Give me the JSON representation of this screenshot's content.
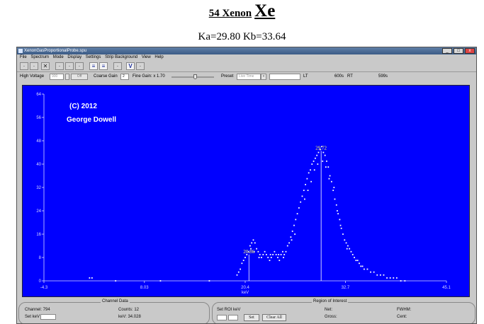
{
  "page": {
    "title_number": "54 Xenon",
    "title_symbol": "Xe",
    "energies": "Ka=29.80 Kb=33.64"
  },
  "window": {
    "title": "XenonGasProportionalProbe.spu"
  },
  "menu": [
    "File",
    "Spectrum",
    "Mode",
    "Display",
    "Settings",
    "Strip Background",
    "View",
    "Help"
  ],
  "controls": {
    "high_voltage_label": "High Voltage",
    "high_voltage_value": "900",
    "off_label": "Off",
    "coarse_gain_label": "Coarse Gain",
    "coarse_gain_value": "2",
    "fine_gain_label": "Fine Gain: x 1.70",
    "preset_label": "Preset",
    "preset_value": "Live Time",
    "lt_label": "LT",
    "time_value": "600s",
    "rt_label": "RT",
    "rt_value": "599s",
    "fine_gain_level": 0.55
  },
  "overlay": {
    "copyright": "(C) 2012",
    "author": "George Dowell"
  },
  "chart_data": {
    "type": "scatter",
    "xlabel": "keV",
    "xlim": [
      -4.3,
      45.1
    ],
    "ylim": [
      0,
      64
    ],
    "x_ticks": [
      "-4.3",
      "8.03",
      "20.4",
      "32.7",
      "45.1"
    ],
    "y_ticks": [
      "0",
      "8",
      "16",
      "24",
      "32",
      "40",
      "48",
      "56",
      "64"
    ],
    "peaks": [
      {
        "label": "20.86",
        "x": 20.86,
        "y": 9.5
      },
      {
        "label": "29.72",
        "x": 29.72,
        "y": 45
      }
    ],
    "points": [
      [
        1.3,
        1
      ],
      [
        1.6,
        1
      ],
      [
        4.5,
        0
      ],
      [
        10,
        0
      ],
      [
        16,
        0
      ],
      [
        19.4,
        2
      ],
      [
        19.6,
        3
      ],
      [
        19.8,
        4
      ],
      [
        20.0,
        6
      ],
      [
        20.2,
        7
      ],
      [
        20.4,
        8
      ],
      [
        20.6,
        9
      ],
      [
        20.8,
        10
      ],
      [
        21.0,
        12
      ],
      [
        21.2,
        13
      ],
      [
        21.4,
        14
      ],
      [
        21.6,
        13
      ],
      [
        21.8,
        11
      ],
      [
        22.0,
        10
      ],
      [
        22.2,
        9
      ],
      [
        22.4,
        8
      ],
      [
        22.6,
        9
      ],
      [
        22.8,
        10
      ],
      [
        23.0,
        9
      ],
      [
        23.2,
        8
      ],
      [
        23.4,
        7
      ],
      [
        23.6,
        8
      ],
      [
        23.8,
        9
      ],
      [
        24.0,
        10
      ],
      [
        24.2,
        9
      ],
      [
        24.4,
        8
      ],
      [
        24.6,
        7
      ],
      [
        24.8,
        9
      ],
      [
        25.0,
        10
      ],
      [
        25.2,
        9
      ],
      [
        25.4,
        10
      ],
      [
        25.6,
        12
      ],
      [
        25.8,
        13
      ],
      [
        26.0,
        15
      ],
      [
        26.2,
        17
      ],
      [
        26.4,
        19
      ],
      [
        26.6,
        21
      ],
      [
        26.8,
        23
      ],
      [
        27.0,
        25
      ],
      [
        27.2,
        27
      ],
      [
        27.4,
        29
      ],
      [
        27.6,
        31
      ],
      [
        27.8,
        33
      ],
      [
        28.0,
        35
      ],
      [
        28.2,
        37
      ],
      [
        28.4,
        38
      ],
      [
        28.6,
        40
      ],
      [
        28.8,
        41
      ],
      [
        29.0,
        42
      ],
      [
        29.2,
        43
      ],
      [
        29.4,
        44
      ],
      [
        29.6,
        45
      ],
      [
        29.8,
        46
      ],
      [
        30.0,
        44
      ],
      [
        30.2,
        43
      ],
      [
        30.4,
        41
      ],
      [
        30.6,
        39
      ],
      [
        30.8,
        36
      ],
      [
        31.0,
        34
      ],
      [
        31.2,
        31
      ],
      [
        31.4,
        28
      ],
      [
        31.6,
        26
      ],
      [
        31.8,
        23
      ],
      [
        32.0,
        21
      ],
      [
        32.2,
        18
      ],
      [
        32.4,
        16
      ],
      [
        32.6,
        14
      ],
      [
        32.8,
        13
      ],
      [
        33.0,
        12
      ],
      [
        33.2,
        11
      ],
      [
        33.4,
        10
      ],
      [
        33.6,
        9
      ],
      [
        33.8,
        8
      ],
      [
        34.0,
        7
      ],
      [
        34.2,
        7
      ],
      [
        34.4,
        6
      ],
      [
        34.6,
        5
      ],
      [
        34.8,
        5
      ],
      [
        35.0,
        4
      ],
      [
        35.4,
        4
      ],
      [
        35.8,
        3
      ],
      [
        36.2,
        3
      ],
      [
        36.6,
        2
      ],
      [
        37.0,
        2
      ],
      [
        37.4,
        2
      ],
      [
        37.8,
        1
      ],
      [
        38.2,
        1
      ],
      [
        38.6,
        1
      ],
      [
        39.0,
        1
      ],
      [
        39.5,
        0
      ],
      [
        40.0,
        0
      ],
      [
        28.5,
        34
      ],
      [
        28.9,
        38
      ],
      [
        29.3,
        40
      ],
      [
        29.9,
        41
      ],
      [
        30.3,
        39
      ],
      [
        30.7,
        35
      ],
      [
        28.1,
        31
      ],
      [
        27.7,
        28
      ],
      [
        31.3,
        32
      ],
      [
        31.7,
        24
      ],
      [
        32.1,
        19
      ],
      [
        26.5,
        16
      ],
      [
        26.1,
        14
      ],
      [
        21.1,
        11
      ],
      [
        21.5,
        10
      ],
      [
        22.1,
        8
      ],
      [
        23.5,
        9
      ],
      [
        24.5,
        9
      ],
      [
        25.1,
        8
      ],
      [
        32.9,
        11
      ]
    ]
  },
  "channel_panel": {
    "legend": "Channel Data",
    "channel": "Channel: 794",
    "counts": "Counts: 12",
    "set_kev": "Set keV",
    "kev": "keV: 34.028"
  },
  "roi_panel": {
    "legend": "Region of Interest",
    "set_roi": "Set ROI keV",
    "set_button": "Set",
    "clear_button": "Clear All",
    "net": "Net:",
    "gross": "Gross:",
    "fwhm": "FWHM:",
    "cent": "Cent:"
  },
  "colors": {
    "plot_bg": "#0000ff",
    "axis": "#d8d8ff",
    "point": "#ffffff",
    "peak_label": "#ffff66"
  }
}
